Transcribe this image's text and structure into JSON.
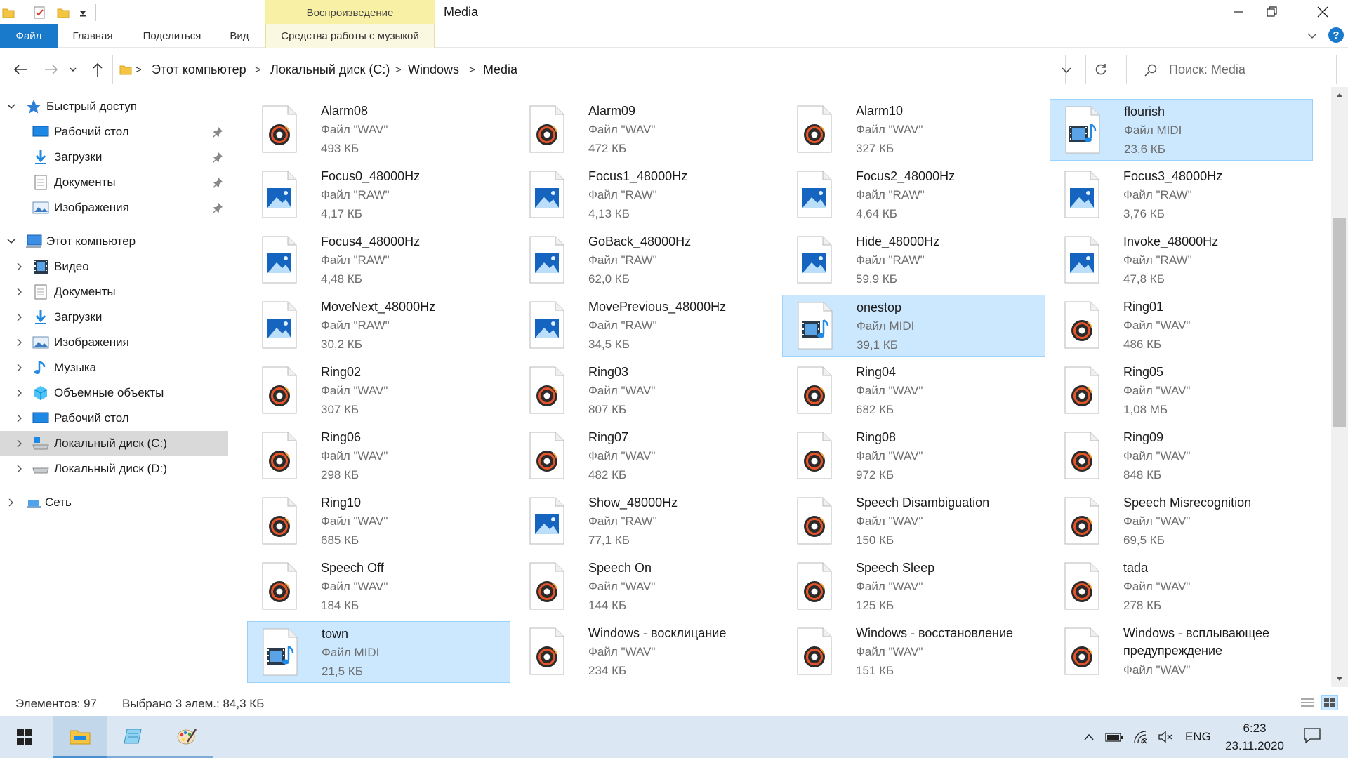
{
  "window": {
    "title": "Media",
    "contextual_tab_header": "Воспроизведение"
  },
  "ribbon": {
    "tabs": [
      "Файл",
      "Главная",
      "Поделиться",
      "Вид",
      "Средства работы с музыкой"
    ]
  },
  "address": {
    "crumbs": [
      "Этот компьютер",
      "Локальный диск (C:)",
      "Windows",
      "Media"
    ],
    "separator": ">"
  },
  "search": {
    "placeholder": "Поиск: Media"
  },
  "sidebar": {
    "quick_access": "Быстрый доступ",
    "quick_items": [
      "Рабочий стол",
      "Загрузки",
      "Документы",
      "Изображения"
    ],
    "this_pc": "Этот компьютер",
    "pc_items": [
      "Видео",
      "Документы",
      "Загрузки",
      "Изображения",
      "Музыка",
      "Объемные объекты",
      "Рабочий стол",
      "Локальный диск (C:)",
      "Локальный диск (D:)"
    ],
    "network": "Сеть"
  },
  "files": [
    {
      "name": "Alarm08",
      "type": "Файл \"WAV\"",
      "size": "493 КБ",
      "icon": "wav",
      "selected": false
    },
    {
      "name": "Alarm09",
      "type": "Файл \"WAV\"",
      "size": "472 КБ",
      "icon": "wav",
      "selected": false
    },
    {
      "name": "Alarm10",
      "type": "Файл \"WAV\"",
      "size": "327 КБ",
      "icon": "wav",
      "selected": false
    },
    {
      "name": "flourish",
      "type": "Файл MIDI",
      "size": "23,6 КБ",
      "icon": "midi",
      "selected": true
    },
    {
      "name": "Focus0_48000Hz",
      "type": "Файл \"RAW\"",
      "size": "4,17 КБ",
      "icon": "raw",
      "selected": false
    },
    {
      "name": "Focus1_48000Hz",
      "type": "Файл \"RAW\"",
      "size": "4,13 КБ",
      "icon": "raw",
      "selected": false
    },
    {
      "name": "Focus2_48000Hz",
      "type": "Файл \"RAW\"",
      "size": "4,64 КБ",
      "icon": "raw",
      "selected": false
    },
    {
      "name": "Focus3_48000Hz",
      "type": "Файл \"RAW\"",
      "size": "3,76 КБ",
      "icon": "raw",
      "selected": false
    },
    {
      "name": "Focus4_48000Hz",
      "type": "Файл \"RAW\"",
      "size": "4,48 КБ",
      "icon": "raw",
      "selected": false
    },
    {
      "name": "GoBack_48000Hz",
      "type": "Файл \"RAW\"",
      "size": "62,0 КБ",
      "icon": "raw",
      "selected": false
    },
    {
      "name": "Hide_48000Hz",
      "type": "Файл \"RAW\"",
      "size": "59,9 КБ",
      "icon": "raw",
      "selected": false
    },
    {
      "name": "Invoke_48000Hz",
      "type": "Файл \"RAW\"",
      "size": "47,8 КБ",
      "icon": "raw",
      "selected": false
    },
    {
      "name": "MoveNext_48000Hz",
      "type": "Файл \"RAW\"",
      "size": "30,2 КБ",
      "icon": "raw",
      "selected": false
    },
    {
      "name": "MovePrevious_48000Hz",
      "type": "Файл \"RAW\"",
      "size": "34,5 КБ",
      "icon": "raw",
      "selected": false
    },
    {
      "name": "onestop",
      "type": "Файл MIDI",
      "size": "39,1 КБ",
      "icon": "midi",
      "selected": true
    },
    {
      "name": "Ring01",
      "type": "Файл \"WAV\"",
      "size": "486 КБ",
      "icon": "wav",
      "selected": false
    },
    {
      "name": "Ring02",
      "type": "Файл \"WAV\"",
      "size": "307 КБ",
      "icon": "wav",
      "selected": false
    },
    {
      "name": "Ring03",
      "type": "Файл \"WAV\"",
      "size": "807 КБ",
      "icon": "wav",
      "selected": false
    },
    {
      "name": "Ring04",
      "type": "Файл \"WAV\"",
      "size": "682 КБ",
      "icon": "wav",
      "selected": false
    },
    {
      "name": "Ring05",
      "type": "Файл \"WAV\"",
      "size": "1,08 МБ",
      "icon": "wav",
      "selected": false
    },
    {
      "name": "Ring06",
      "type": "Файл \"WAV\"",
      "size": "298 КБ",
      "icon": "wav",
      "selected": false
    },
    {
      "name": "Ring07",
      "type": "Файл \"WAV\"",
      "size": "482 КБ",
      "icon": "wav",
      "selected": false
    },
    {
      "name": "Ring08",
      "type": "Файл \"WAV\"",
      "size": "972 КБ",
      "icon": "wav",
      "selected": false
    },
    {
      "name": "Ring09",
      "type": "Файл \"WAV\"",
      "size": "848 КБ",
      "icon": "wav",
      "selected": false
    },
    {
      "name": "Ring10",
      "type": "Файл \"WAV\"",
      "size": "685 КБ",
      "icon": "wav",
      "selected": false
    },
    {
      "name": "Show_48000Hz",
      "type": "Файл \"RAW\"",
      "size": "77,1 КБ",
      "icon": "raw",
      "selected": false
    },
    {
      "name": "Speech Disambiguation",
      "type": "Файл \"WAV\"",
      "size": "150 КБ",
      "icon": "wav",
      "selected": false
    },
    {
      "name": "Speech Misrecognition",
      "type": "Файл \"WAV\"",
      "size": "69,5 КБ",
      "icon": "wav",
      "selected": false
    },
    {
      "name": "Speech Off",
      "type": "Файл \"WAV\"",
      "size": "184 КБ",
      "icon": "wav",
      "selected": false
    },
    {
      "name": "Speech On",
      "type": "Файл \"WAV\"",
      "size": "144 КБ",
      "icon": "wav",
      "selected": false
    },
    {
      "name": "Speech Sleep",
      "type": "Файл \"WAV\"",
      "size": "125 КБ",
      "icon": "wav",
      "selected": false
    },
    {
      "name": "tada",
      "type": "Файл \"WAV\"",
      "size": "278 КБ",
      "icon": "wav",
      "selected": false
    },
    {
      "name": "town",
      "type": "Файл MIDI",
      "size": "21,5 КБ",
      "icon": "midi",
      "selected": true
    },
    {
      "name": "Windows - восклицание",
      "type": "Файл \"WAV\"",
      "size": "234 КБ",
      "icon": "wav",
      "selected": false
    },
    {
      "name": "Windows - восстановление",
      "type": "Файл \"WAV\"",
      "size": "151 КБ",
      "icon": "wav",
      "selected": false
    },
    {
      "name": "Windows - всплывающее предупреждение",
      "type": "Файл \"WAV\"",
      "size": "",
      "icon": "wav",
      "selected": false
    }
  ],
  "status": {
    "count": "Элементов: 97",
    "selection": "Выбрано 3 элем.: 84,3 КБ"
  },
  "tray": {
    "lang": "ENG",
    "time": "6:23",
    "date": "23.11.2020"
  },
  "colors": {
    "accent": "#1979ca",
    "selection_bg": "#cce8ff",
    "selection_border": "#99d1ff",
    "context_tab": "#f8f0a4"
  }
}
